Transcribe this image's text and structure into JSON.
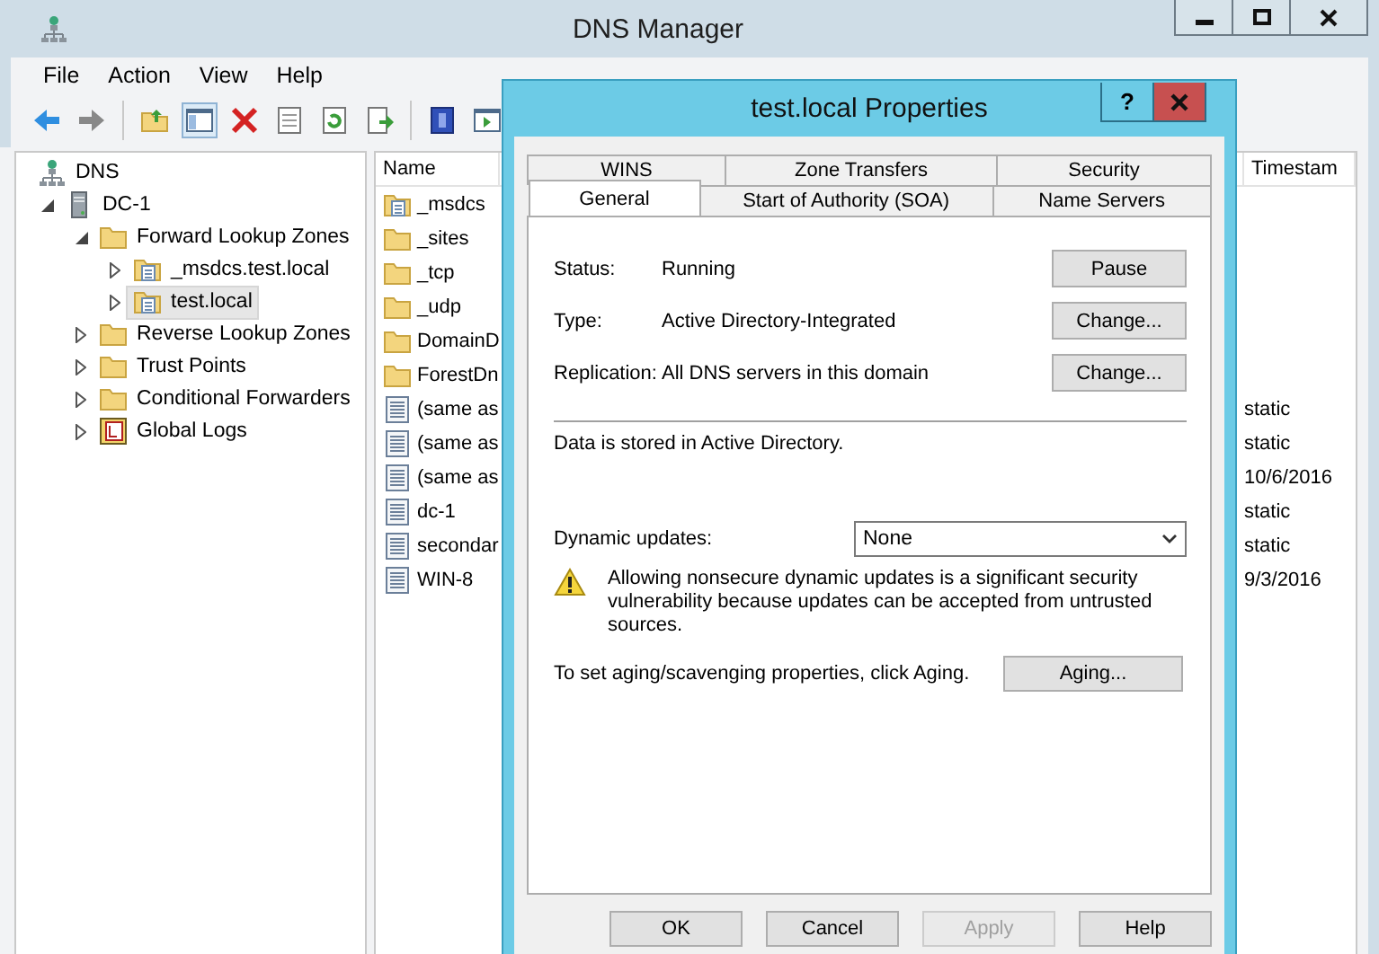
{
  "window": {
    "title": "DNS Manager"
  },
  "menu": [
    "File",
    "Action",
    "View",
    "Help"
  ],
  "tree": [
    {
      "label": "DNS",
      "kind": "dns",
      "selected": false,
      "children": [
        {
          "label": "DC-1",
          "kind": "server",
          "expanded": true,
          "selected": false,
          "children": [
            {
              "label": "Forward Lookup Zones",
              "kind": "folder",
              "expanded": true,
              "selected": false,
              "children": [
                {
                  "label": "_msdcs.test.local",
                  "kind": "zone",
                  "expanded": false,
                  "selected": false
                },
                {
                  "label": "test.local",
                  "kind": "zone",
                  "expanded": false,
                  "selected": true
                }
              ]
            },
            {
              "label": "Reverse Lookup Zones",
              "kind": "folder",
              "expanded": false,
              "selected": false
            },
            {
              "label": "Trust Points",
              "kind": "folder",
              "expanded": false,
              "selected": false
            },
            {
              "label": "Conditional Forwarders",
              "kind": "folder",
              "expanded": false,
              "selected": false
            },
            {
              "label": "Global Logs",
              "kind": "logs",
              "expanded": false,
              "selected": false
            }
          ]
        }
      ]
    }
  ],
  "list": {
    "columns": [
      "Name",
      "Timestam"
    ],
    "rows": [
      {
        "kind": "zone",
        "name": "_msdcs"
      },
      {
        "kind": "folder",
        "name": "_sites"
      },
      {
        "kind": "folder",
        "name": "_tcp"
      },
      {
        "kind": "folder",
        "name": "_udp"
      },
      {
        "kind": "folder",
        "name": "DomainD"
      },
      {
        "kind": "folder",
        "name": "ForestDn"
      },
      {
        "kind": "record",
        "name": "(same as",
        "timestamp": "static"
      },
      {
        "kind": "record",
        "name": "(same as",
        "timestamp": "static"
      },
      {
        "kind": "record",
        "name": "(same as",
        "timestamp": "10/6/2016"
      },
      {
        "kind": "record",
        "name": "dc-1",
        "timestamp": "static"
      },
      {
        "kind": "record",
        "name": "secondar",
        "timestamp": "static"
      },
      {
        "kind": "record",
        "name": "WIN-8",
        "timestamp": "9/3/2016"
      }
    ]
  },
  "dialog": {
    "title": "test.local Properties",
    "help_button": "?",
    "tab_rows": [
      [
        {
          "label": "WINS",
          "selected": false
        },
        {
          "label": "Zone Transfers",
          "selected": false
        },
        {
          "label": "Security",
          "selected": false
        }
      ],
      [
        {
          "label": "General",
          "selected": true
        },
        {
          "label": "Start of Authority (SOA)",
          "selected": false
        },
        {
          "label": "Name Servers",
          "selected": false
        }
      ]
    ],
    "fields": [
      {
        "label": "Status:",
        "value": "Running",
        "button": "Pause"
      },
      {
        "label": "Type:",
        "value": "Active Directory-Integrated",
        "button": "Change..."
      },
      {
        "label": "Replication:",
        "value": "All DNS servers in this domain",
        "button": "Change..."
      }
    ],
    "storage_note": "Data is stored in Active Directory.",
    "dynamic_updates": {
      "label": "Dynamic updates:",
      "value": "None"
    },
    "warning": "Allowing nonsecure dynamic updates is a significant security vulnerability because updates can be accepted from untrusted sources.",
    "aging": {
      "text": "To set aging/scavenging properties, click Aging.",
      "button": "Aging..."
    },
    "buttons": [
      {
        "label": "OK",
        "disabled": false
      },
      {
        "label": "Cancel",
        "disabled": false
      },
      {
        "label": "Apply",
        "disabled": true
      },
      {
        "label": "Help",
        "disabled": false
      }
    ]
  }
}
